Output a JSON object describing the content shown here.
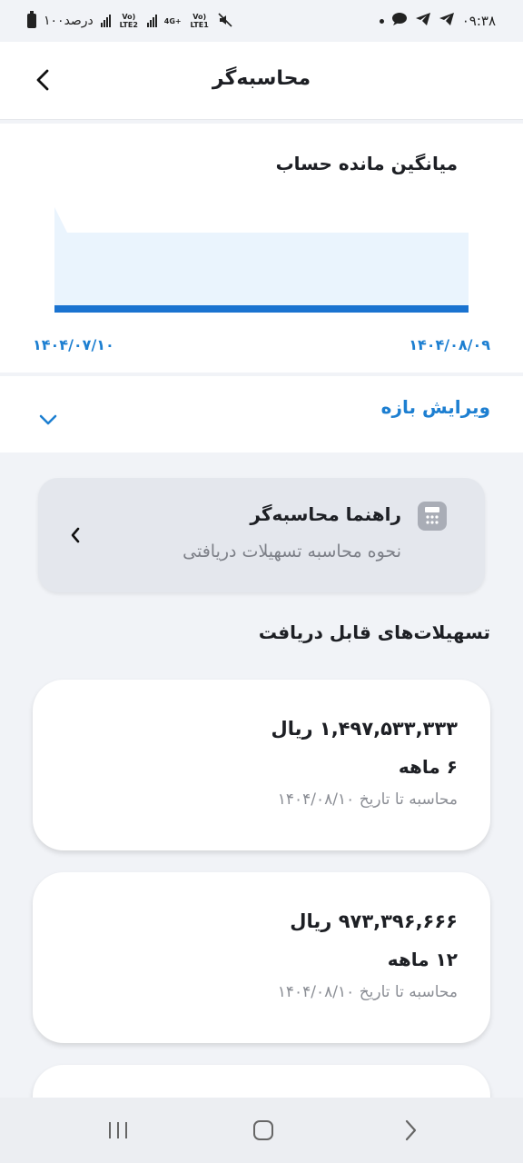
{
  "status_bar": {
    "time": "۰۹:۳۸",
    "battery": "۱۰۰درصد",
    "sim1": "Vo) LTE1",
    "sim1_net": "4G+",
    "sim2": "Vo) LTE2"
  },
  "header": {
    "title": "محاسبه‌گر"
  },
  "chart": {
    "title": "میانگین مانده حساب",
    "start_date": "۱۴۰۴/۰۷/۱۰",
    "end_date": "۱۴۰۴/۰۸/۰۹",
    "chart_data": {
      "type": "area",
      "x": [
        "۱۴۰۴/۰۷/۱۰",
        "۱۴۰۴/۰۸/۰۹"
      ],
      "values": [
        0,
        0
      ],
      "line_color": "#1a73d0",
      "fill_color": "#eaf4fd"
    }
  },
  "range": {
    "label": "ویرایش بازه"
  },
  "guide": {
    "title": "راهنما محاسبه‌گر",
    "subtitle": "نحوه محاسبه تسهیلات دریافتی"
  },
  "loans": {
    "section_title": "تسهیلات‌های قابل دریافت",
    "items": [
      {
        "amount": "۱,۴۹۷,۵۳۳,۳۳۳ ریال",
        "term": "۶ ماهه",
        "date_note": "محاسبه تا تاریخ ۱۴۰۴/۰۸/۱۰"
      },
      {
        "amount": "۹۷۳,۳۹۶,۶۶۶ ریال",
        "term": "۱۲ ماهه",
        "date_note": "محاسبه تا تاریخ ۱۴۰۴/۰۸/۱۰"
      }
    ]
  },
  "colors": {
    "accent": "#1d7fd1",
    "background": "#f1f3f7"
  }
}
